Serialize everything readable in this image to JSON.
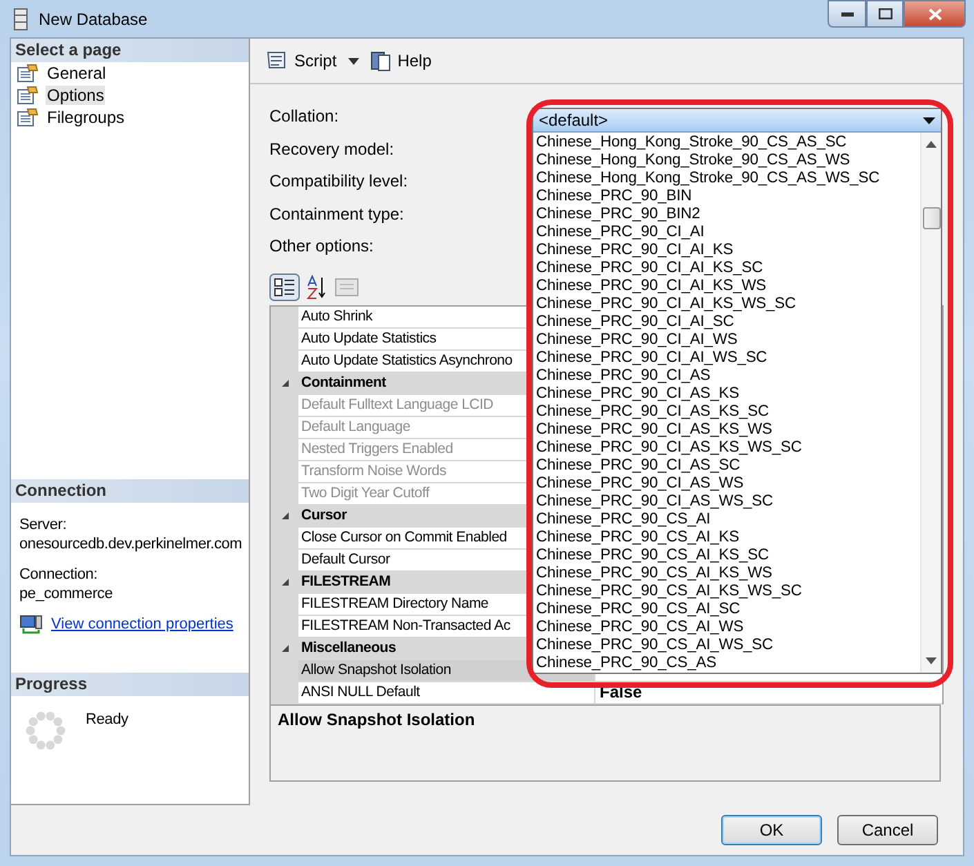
{
  "window": {
    "title": "New Database"
  },
  "sidebar": {
    "header": "Select a page",
    "pages": [
      {
        "label": "General",
        "selected": false
      },
      {
        "label": "Options",
        "selected": true
      },
      {
        "label": "Filegroups",
        "selected": false
      }
    ]
  },
  "connection": {
    "header": "Connection",
    "server_label": "Server:",
    "server": "onesourcedb.dev.perkinelmer.com",
    "connection_label": "Connection:",
    "connection": "pe_commerce",
    "link": "View connection properties"
  },
  "progress": {
    "header": "Progress",
    "status": "Ready"
  },
  "toolbar": {
    "script": "Script",
    "help": "Help"
  },
  "form": {
    "fields": [
      "Collation:",
      "Recovery model:",
      "Compatibility level:",
      "Containment type:"
    ],
    "other_options": "Other options:"
  },
  "property_grid": {
    "rows": [
      {
        "kind": "property",
        "name": "Auto Shrink",
        "disabled": false,
        "selected": false
      },
      {
        "kind": "property",
        "name": "Auto Update Statistics",
        "disabled": false,
        "selected": false
      },
      {
        "kind": "property",
        "name": "Auto Update Statistics Asynchrono",
        "disabled": false,
        "selected": false
      },
      {
        "kind": "category",
        "name": "Containment",
        "expanded": true
      },
      {
        "kind": "property",
        "name": "Default Fulltext Language LCID",
        "disabled": true,
        "selected": false
      },
      {
        "kind": "property",
        "name": "Default Language",
        "disabled": true,
        "selected": false
      },
      {
        "kind": "property",
        "name": "Nested Triggers Enabled",
        "disabled": true,
        "selected": false
      },
      {
        "kind": "property",
        "name": "Transform Noise Words",
        "disabled": true,
        "selected": false
      },
      {
        "kind": "property",
        "name": "Two Digit Year Cutoff",
        "disabled": true,
        "selected": false
      },
      {
        "kind": "category",
        "name": "Cursor",
        "expanded": true
      },
      {
        "kind": "property",
        "name": "Close Cursor on Commit Enabled",
        "disabled": false,
        "selected": false
      },
      {
        "kind": "property",
        "name": "Default Cursor",
        "disabled": false,
        "selected": false
      },
      {
        "kind": "category",
        "name": "FILESTREAM",
        "expanded": true
      },
      {
        "kind": "property",
        "name": "FILESTREAM Directory Name",
        "disabled": false,
        "selected": false
      },
      {
        "kind": "property",
        "name": "FILESTREAM Non-Transacted Ac",
        "disabled": false,
        "selected": false
      },
      {
        "kind": "category",
        "name": "Miscellaneous",
        "expanded": true
      },
      {
        "kind": "property",
        "name": "Allow Snapshot Isolation",
        "disabled": false,
        "selected": true
      },
      {
        "kind": "property",
        "name": "ANSI NULL Default",
        "value": "False",
        "disabled": false,
        "selected": false
      }
    ]
  },
  "description": {
    "title": "Allow Snapshot Isolation"
  },
  "collation_dropdown": {
    "value": "<default>",
    "options": [
      "Chinese_Hong_Kong_Stroke_90_CS_AS_SC",
      "Chinese_Hong_Kong_Stroke_90_CS_AS_WS",
      "Chinese_Hong_Kong_Stroke_90_CS_AS_WS_SC",
      "Chinese_PRC_90_BIN",
      "Chinese_PRC_90_BIN2",
      "Chinese_PRC_90_CI_AI",
      "Chinese_PRC_90_CI_AI_KS",
      "Chinese_PRC_90_CI_AI_KS_SC",
      "Chinese_PRC_90_CI_AI_KS_WS",
      "Chinese_PRC_90_CI_AI_KS_WS_SC",
      "Chinese_PRC_90_CI_AI_SC",
      "Chinese_PRC_90_CI_AI_WS",
      "Chinese_PRC_90_CI_AI_WS_SC",
      "Chinese_PRC_90_CI_AS",
      "Chinese_PRC_90_CI_AS_KS",
      "Chinese_PRC_90_CI_AS_KS_SC",
      "Chinese_PRC_90_CI_AS_KS_WS",
      "Chinese_PRC_90_CI_AS_KS_WS_SC",
      "Chinese_PRC_90_CI_AS_SC",
      "Chinese_PRC_90_CI_AS_WS",
      "Chinese_PRC_90_CI_AS_WS_SC",
      "Chinese_PRC_90_CS_AI",
      "Chinese_PRC_90_CS_AI_KS",
      "Chinese_PRC_90_CS_AI_KS_SC",
      "Chinese_PRC_90_CS_AI_KS_WS",
      "Chinese_PRC_90_CS_AI_KS_WS_SC",
      "Chinese_PRC_90_CS_AI_SC",
      "Chinese_PRC_90_CS_AI_WS",
      "Chinese_PRC_90_CS_AI_WS_SC",
      "Chinese_PRC_90_CS_AS"
    ]
  },
  "buttons": [
    {
      "label": "OK",
      "default": true
    },
    {
      "label": "Cancel",
      "default": false
    }
  ]
}
